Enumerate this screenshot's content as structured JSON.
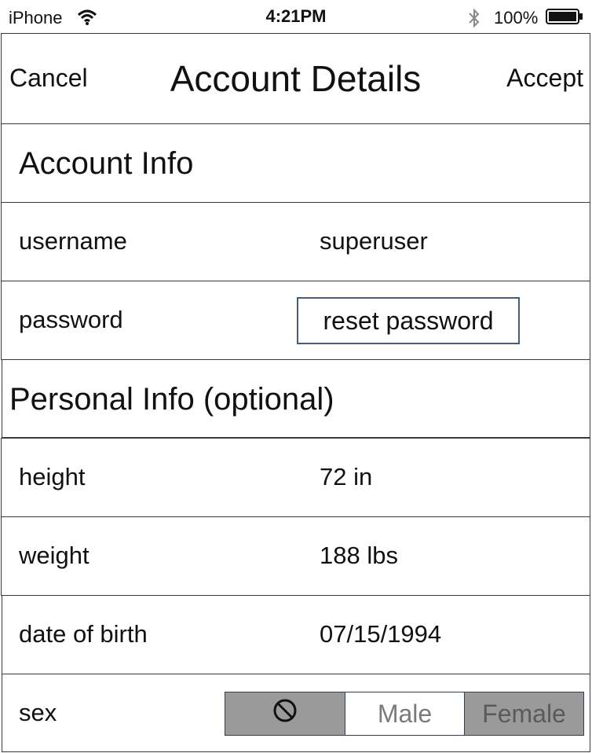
{
  "status_bar": {
    "carrier": "iPhone",
    "time": "4:21PM",
    "battery_percent": "100%",
    "icons": [
      "wifi-icon",
      "bluetooth-icon",
      "battery-icon"
    ]
  },
  "nav": {
    "cancel_label": "Cancel",
    "title": "Account Details",
    "accept_label": "Accept"
  },
  "account_info": {
    "header": "Account Info",
    "username_label": "username",
    "username_value": "superuser",
    "password_label": "password",
    "reset_password_label": "reset password"
  },
  "personal_info": {
    "header": "Personal Info (optional)",
    "height_label": "height",
    "height_value": "72 in",
    "weight_label": "weight",
    "weight_value": "188 lbs",
    "dob_label": "date of birth",
    "dob_value": "07/15/1994",
    "sex_label": "sex",
    "sex_options": {
      "none_icon": "no-entry-icon",
      "male": "Male",
      "female": "Female"
    }
  },
  "colors": {
    "segment_selected": "#9a9a9a",
    "border": "#3a3a3a",
    "button_border": "#4a5f72"
  }
}
